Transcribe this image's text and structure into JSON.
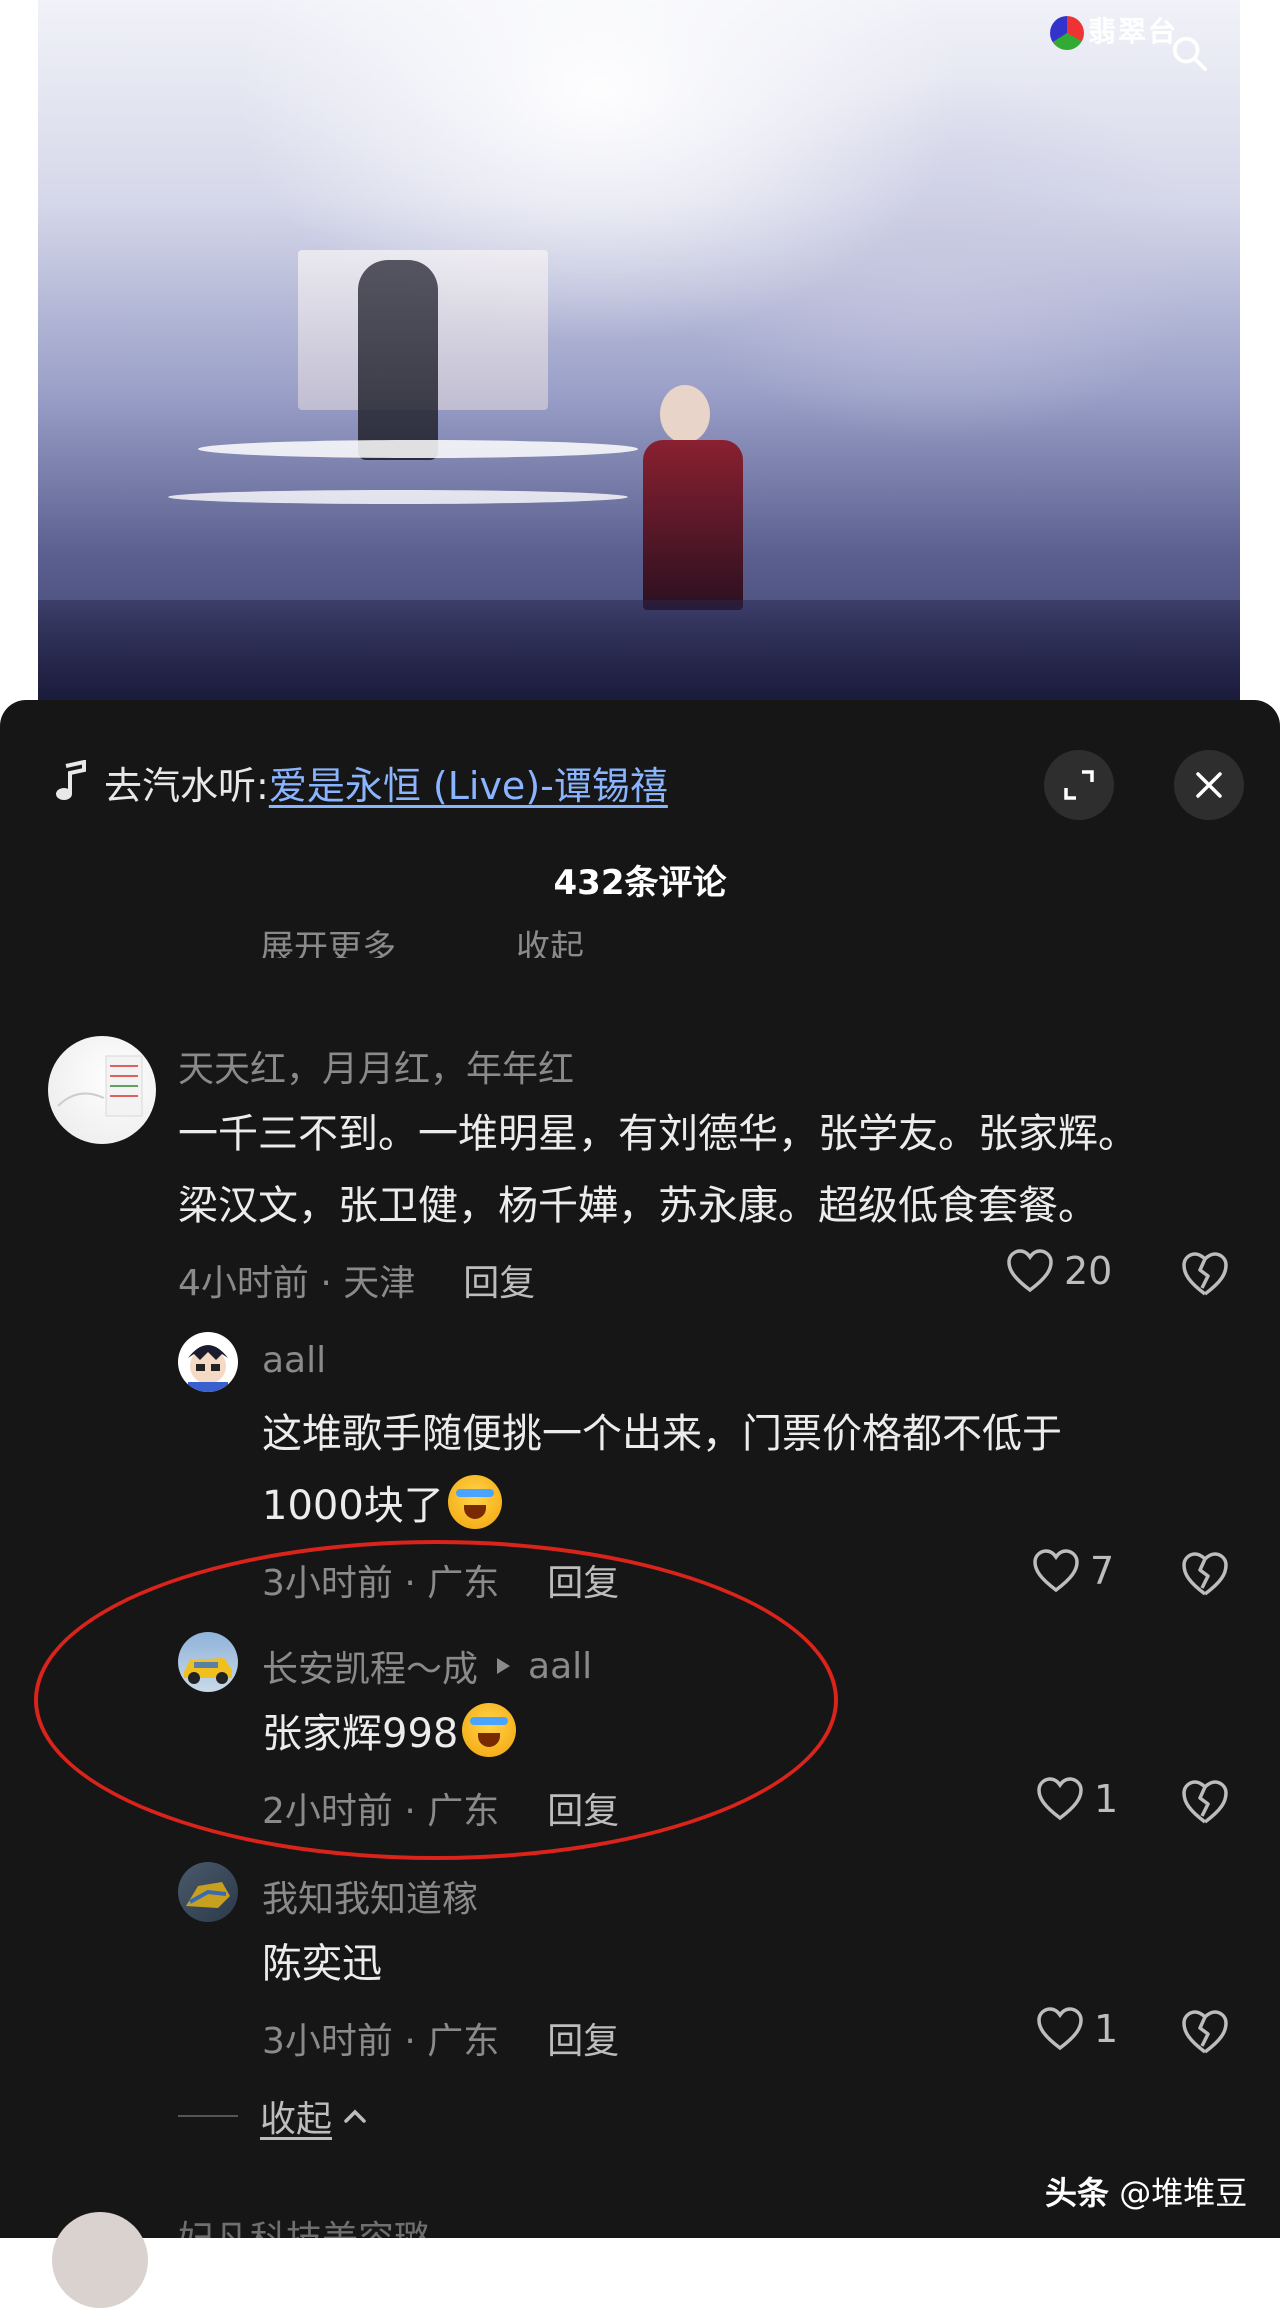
{
  "video": {
    "logo_text": "翡翠台"
  },
  "music": {
    "prefix": "去汽水听:",
    "song": "爱是永恒 (Live)-谭锡禧"
  },
  "comments_header": {
    "count_label": "432条评论"
  },
  "truncated_row": {
    "expand_label": "展开更多",
    "collapse_label": "收起"
  },
  "comments": [
    {
      "author": "天天红，月月红，年年红",
      "lines": [
        "一千三不到。一堆明星，有刘德华，张学友。张家辉。",
        "梁汉文，张卫健，杨千嬅，苏永康。超级低食套餐。"
      ],
      "time_location": "4小时前 · 天津",
      "reply_label": "回复",
      "likes": "20"
    }
  ],
  "replies": [
    {
      "author": "aall",
      "line1": "这堆歌手随便挑一个出来，门票价格都不低于",
      "line2": "1000块了",
      "time_location": "3小时前 · 广东",
      "reply_label": "回复",
      "likes": "7"
    },
    {
      "author": "长安凯程～成",
      "reply_to": "aall",
      "line1": "张家辉998",
      "time_location": "2小时前 · 广东",
      "reply_label": "回复",
      "likes": "1"
    },
    {
      "author": "我知我知道稼",
      "line1": "陈奕迅",
      "time_location": "3小时前 · 广东",
      "reply_label": "回复",
      "likes": "1"
    }
  ],
  "collapse_label": "收起",
  "next_author": "妃凡科技美容璐",
  "watermark": {
    "brand": "头条",
    "handle": "@堆堆豆"
  }
}
